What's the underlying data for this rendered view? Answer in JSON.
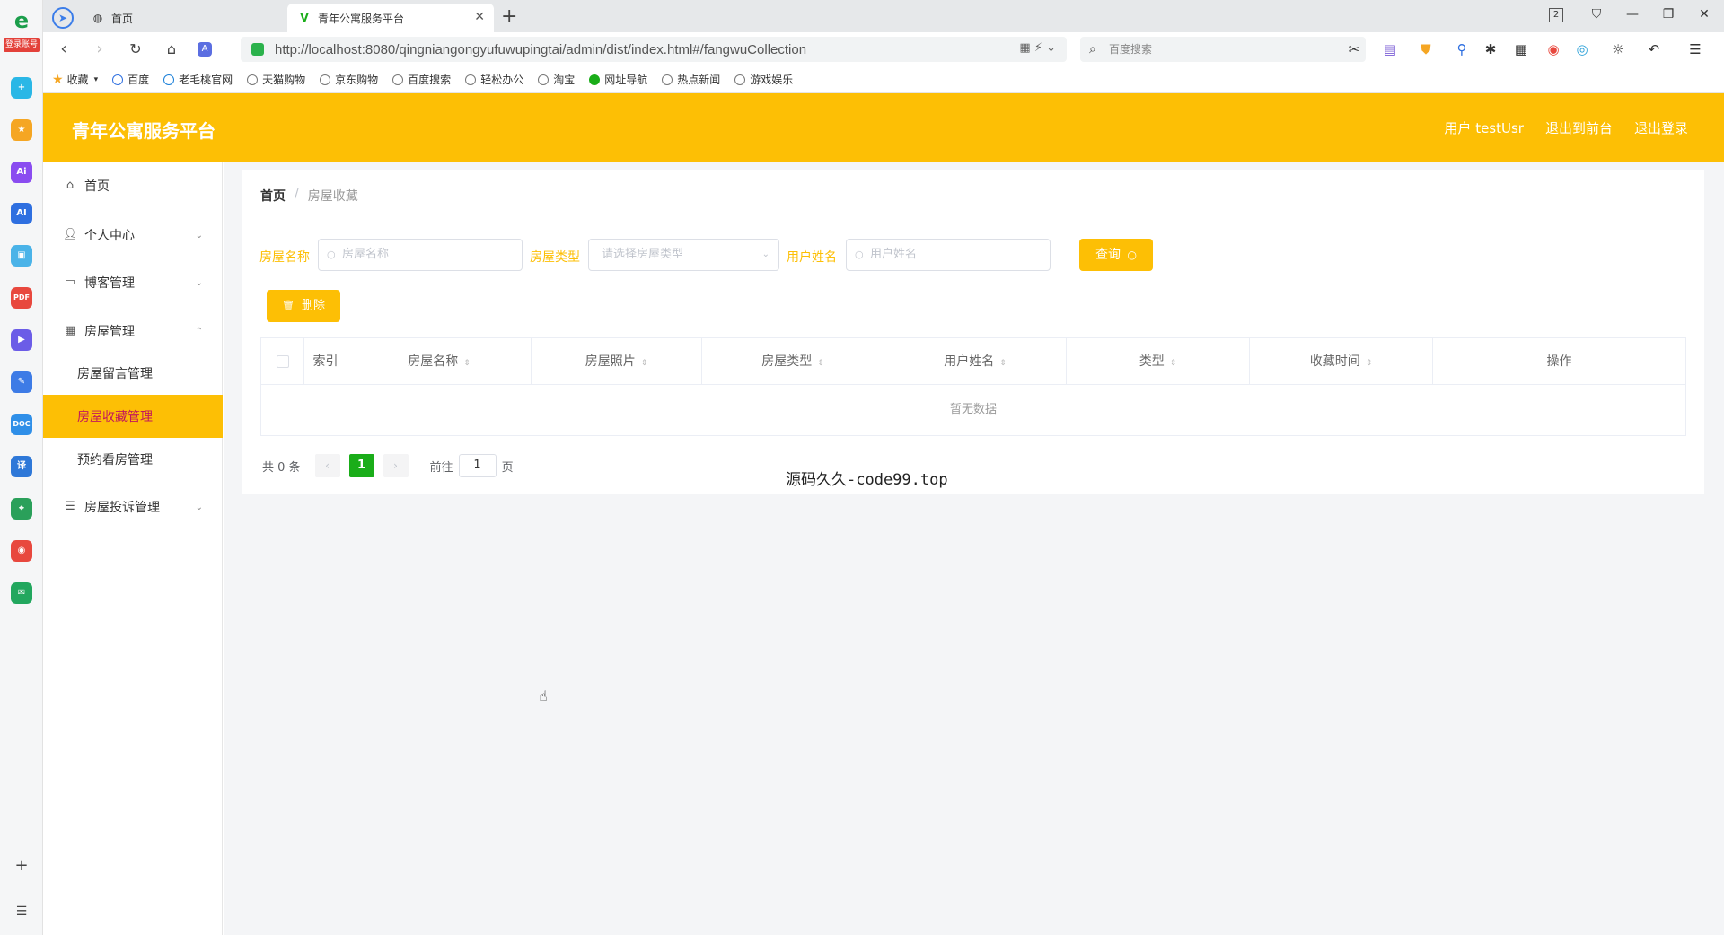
{
  "browser": {
    "tabs": [
      {
        "label": "首页"
      },
      {
        "label": "青年公寓服务平台"
      }
    ],
    "new_tab_label": "+",
    "url": "http://localhost:8080/qingniangongyufuwupingtai/admin/dist/index.html#/fangwuCollection",
    "search_placeholder": "百度搜索",
    "window_badge": "2",
    "dock_login_tag": "登录账号",
    "bookmarks": [
      {
        "label": "收藏"
      },
      {
        "label": "百度"
      },
      {
        "label": "老毛桃官网"
      },
      {
        "label": "天猫购物"
      },
      {
        "label": "京东购物"
      },
      {
        "label": "百度搜索"
      },
      {
        "label": "轻松办公"
      },
      {
        "label": "淘宝"
      },
      {
        "label": "网址导航"
      },
      {
        "label": "热点新闻"
      },
      {
        "label": "游戏娱乐"
      }
    ]
  },
  "header": {
    "title": "青年公寓服务平台",
    "user": "用户 testUsr",
    "back_to_front": "退出到前台",
    "logout": "退出登录"
  },
  "sidebar": {
    "home": "首页",
    "personal": "个人中心",
    "blog": "博客管理",
    "house": "房屋管理",
    "house_message": "房屋留言管理",
    "house_collection": "房屋收藏管理",
    "house_booking": "预约看房管理",
    "complaint": "房屋投诉管理"
  },
  "breadcrumb": {
    "home": "首页",
    "separator": "/",
    "current": "房屋收藏"
  },
  "filters": {
    "house_name_label": "房屋名称",
    "house_name_placeholder": "房屋名称",
    "house_type_label": "房屋类型",
    "house_type_placeholder": "请选择房屋类型",
    "user_name_label": "用户姓名",
    "user_name_placeholder": "用户姓名",
    "query_button": "查询"
  },
  "actions": {
    "delete_button": "删除"
  },
  "table": {
    "columns": [
      "索引",
      "房屋名称",
      "房屋照片",
      "房屋类型",
      "用户姓名",
      "类型",
      "收藏时间",
      "操作"
    ],
    "empty_text": "暂无数据"
  },
  "pagination": {
    "total": "共 0 条",
    "prev": "‹",
    "current_page": "1",
    "next": "›",
    "goto_prefix": "前往",
    "goto_value": "1",
    "goto_suffix": "页"
  },
  "watermark": "源码久久-code99.top"
}
